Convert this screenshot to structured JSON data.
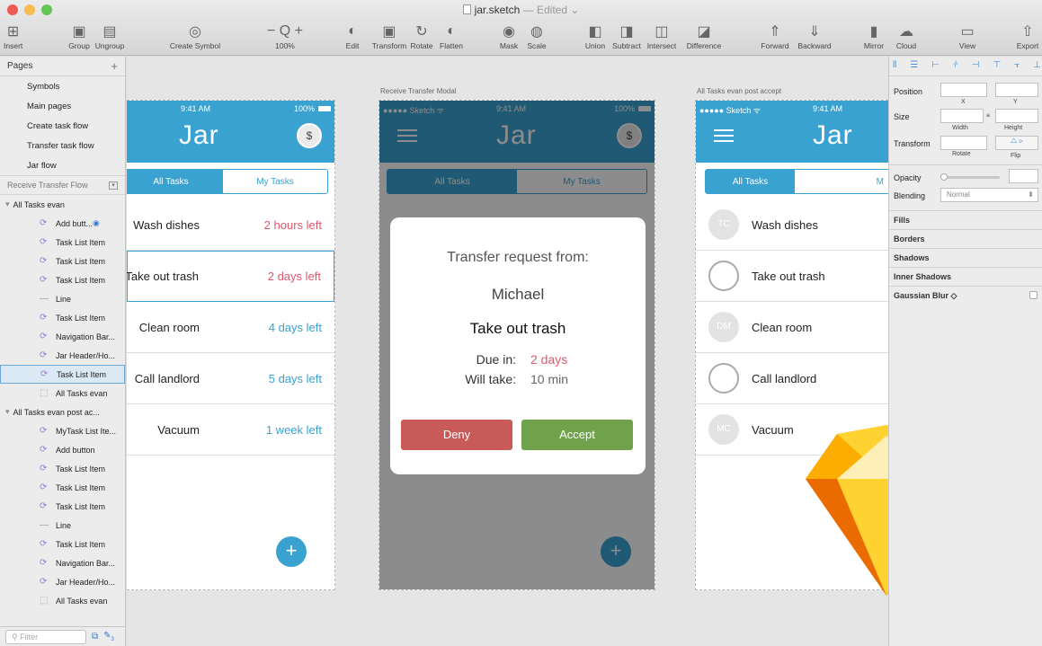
{
  "window": {
    "title": "jar.sketch",
    "subtitle": "— Edited",
    "lights": [
      "#ee5a52",
      "#f5bd4f",
      "#62c555"
    ]
  },
  "toolbar": [
    {
      "id": "insert",
      "label": "Insert",
      "icon": "plus-square-icon",
      "glyph": "⊞"
    },
    {
      "id": "group",
      "label": "Group",
      "icon": "group-icon",
      "glyph": "▣"
    },
    {
      "id": "ungroup",
      "label": "Ungroup",
      "icon": "ungroup-icon",
      "glyph": "▤"
    },
    {
      "id": "create-symbol",
      "label": "Create Symbol",
      "icon": "symbol-icon",
      "glyph": "◎"
    },
    {
      "id": "zoom",
      "label": "100%",
      "icon": "zoom-icon",
      "glyph": "− Q +"
    },
    {
      "id": "edit",
      "label": "Edit",
      "icon": "edit-icon",
      "glyph": "◐"
    },
    {
      "id": "transform",
      "label": "Transform",
      "icon": "transform-icon",
      "glyph": "▣"
    },
    {
      "id": "rotate",
      "label": "Rotate",
      "icon": "rotate-icon",
      "glyph": "↻"
    },
    {
      "id": "flatten",
      "label": "Flatten",
      "icon": "flatten-icon",
      "glyph": "◐"
    },
    {
      "id": "mask",
      "label": "Mask",
      "icon": "mask-icon",
      "glyph": "◉"
    },
    {
      "id": "scale",
      "label": "Scale",
      "icon": "scale-icon",
      "glyph": "◍"
    },
    {
      "id": "union",
      "label": "Union",
      "icon": "union-icon",
      "glyph": "◧"
    },
    {
      "id": "subtract",
      "label": "Subtract",
      "icon": "subtract-icon",
      "glyph": "◨"
    },
    {
      "id": "intersect",
      "label": "Intersect",
      "icon": "intersect-icon",
      "glyph": "◫"
    },
    {
      "id": "difference",
      "label": "Difference",
      "icon": "difference-icon",
      "glyph": "◪"
    },
    {
      "id": "forward",
      "label": "Forward",
      "icon": "forward-icon",
      "glyph": "⇑"
    },
    {
      "id": "backward",
      "label": "Backward",
      "icon": "backward-icon",
      "glyph": "⇓"
    },
    {
      "id": "mirror",
      "label": "Mirror",
      "icon": "mirror-icon",
      "glyph": "▮"
    },
    {
      "id": "cloud",
      "label": "Cloud",
      "icon": "cloud-icon",
      "glyph": "☁"
    },
    {
      "id": "view",
      "label": "View",
      "icon": "view-icon",
      "glyph": "▭"
    },
    {
      "id": "export",
      "label": "Export",
      "icon": "export-icon",
      "glyph": "⇧"
    }
  ],
  "pages": {
    "header": "Pages",
    "items": [
      "Symbols",
      "Main pages",
      "Create task flow",
      "Transfer task flow",
      "Jar flow"
    ]
  },
  "layers": {
    "section": "Receive Transfer Flow",
    "rows": [
      {
        "label": "All Tasks evan",
        "type": "group",
        "sel": false
      },
      {
        "label": "Add butt...",
        "type": "symbol",
        "sel": false,
        "eye": true
      },
      {
        "label": "Task List Item",
        "type": "symbol",
        "sel": false
      },
      {
        "label": "Task List Item",
        "type": "symbol",
        "sel": false
      },
      {
        "label": "Task List Item",
        "type": "symbol",
        "sel": false
      },
      {
        "label": "Line",
        "type": "line",
        "sel": false
      },
      {
        "label": "Task List Item",
        "type": "symbol",
        "sel": false
      },
      {
        "label": "Navigation Bar...",
        "type": "symbol",
        "sel": false
      },
      {
        "label": "Jar Header/Ho...",
        "type": "symbol",
        "sel": false
      },
      {
        "label": "Task List Item",
        "type": "symbol",
        "sel": true
      },
      {
        "label": "All Tasks evan",
        "type": "artboard",
        "sel": false
      },
      {
        "label": "All Tasks evan post ac...",
        "type": "group",
        "sel": false
      },
      {
        "label": "MyTask List Ite...",
        "type": "symbol",
        "sel": false
      },
      {
        "label": "Add button",
        "type": "symbol",
        "sel": false
      },
      {
        "label": "Task List Item",
        "type": "symbol",
        "sel": false
      },
      {
        "label": "Task List Item",
        "type": "symbol",
        "sel": false
      },
      {
        "label": "Task List Item",
        "type": "symbol",
        "sel": false
      },
      {
        "label": "Line",
        "type": "line",
        "sel": false
      },
      {
        "label": "Task List Item",
        "type": "symbol",
        "sel": false
      },
      {
        "label": "Navigation Bar...",
        "type": "symbol",
        "sel": false
      },
      {
        "label": "Jar Header/Ho...",
        "type": "symbol",
        "sel": false
      },
      {
        "label": "All Tasks evan",
        "type": "artboard",
        "sel": false
      }
    ],
    "filter_placeholder": "Filter",
    "count": "3"
  },
  "artboards": {
    "left": {
      "status_time": "9:41 AM",
      "status_battery": "100%",
      "logo": "Jar",
      "coin": "$",
      "tab_all": "All Tasks",
      "tab_my": "My Tasks",
      "tasks": [
        {
          "name": "Wash dishes",
          "due": "2 hours left",
          "color": "#e0566b"
        },
        {
          "name": "Take out trash",
          "due": "2 days left",
          "color": "#e0566b"
        },
        {
          "name": "Clean room",
          "due": "4 days left",
          "color": "#3aa2d1"
        },
        {
          "name": "Call landlord",
          "due": "5 days left",
          "color": "#3aa2d1"
        },
        {
          "name": "Vacuum",
          "due": "1 week left",
          "color": "#3aa2d1"
        }
      ],
      "fab": "+"
    },
    "middle": {
      "label": "Receive Transfer Modal",
      "status_carrier": "●●●●● Sketch ᯤ",
      "status_time": "9:41 AM",
      "status_battery": "100%",
      "logo": "Jar",
      "coin": "$",
      "tab_all": "All Tasks",
      "tab_my": "My Tasks",
      "modal": {
        "heading": "Transfer request from:",
        "sender": "Michael",
        "task": "Take out trash",
        "due_label": "Due in:",
        "due_value": "2 days",
        "take_label": "Will take:",
        "take_value": "10 min",
        "deny": "Deny",
        "accept": "Accept"
      },
      "fab": "+"
    },
    "right": {
      "label": "All Tasks evan post accept",
      "status_carrier": "●●●●● Sketch ᯤ",
      "status_time": "9:41 AM",
      "logo": "Jar",
      "tab_all": "All Tasks",
      "tab_my": "M",
      "tasks": [
        {
          "name": "Wash dishes",
          "avatar": "TC",
          "filled": true
        },
        {
          "name": "Take out trash",
          "avatar": "",
          "filled": false
        },
        {
          "name": "Clean room",
          "avatar": "DM",
          "filled": true
        },
        {
          "name": "Call landlord",
          "avatar": "",
          "filled": false
        },
        {
          "name": "Vacuum",
          "avatar": "MC",
          "filled": true
        }
      ]
    }
  },
  "inspector": {
    "position": "Position",
    "x": "X",
    "y": "Y",
    "size": "Size",
    "width": "Width",
    "height": "Height",
    "transform": "Transform",
    "rotate": "Rotate",
    "flip": "Flip",
    "opacity": "Opacity",
    "blending": "Blending",
    "blending_value": "Normal",
    "sections": [
      "Fills",
      "Borders",
      "Shadows",
      "Inner Shadows",
      "Gaussian Blur ◇"
    ]
  },
  "colors": {
    "brand_blue": "#3aa2d1",
    "urgent_red": "#e0566b",
    "deny_red": "#c85a5a",
    "accept_green": "#6fa24a"
  }
}
